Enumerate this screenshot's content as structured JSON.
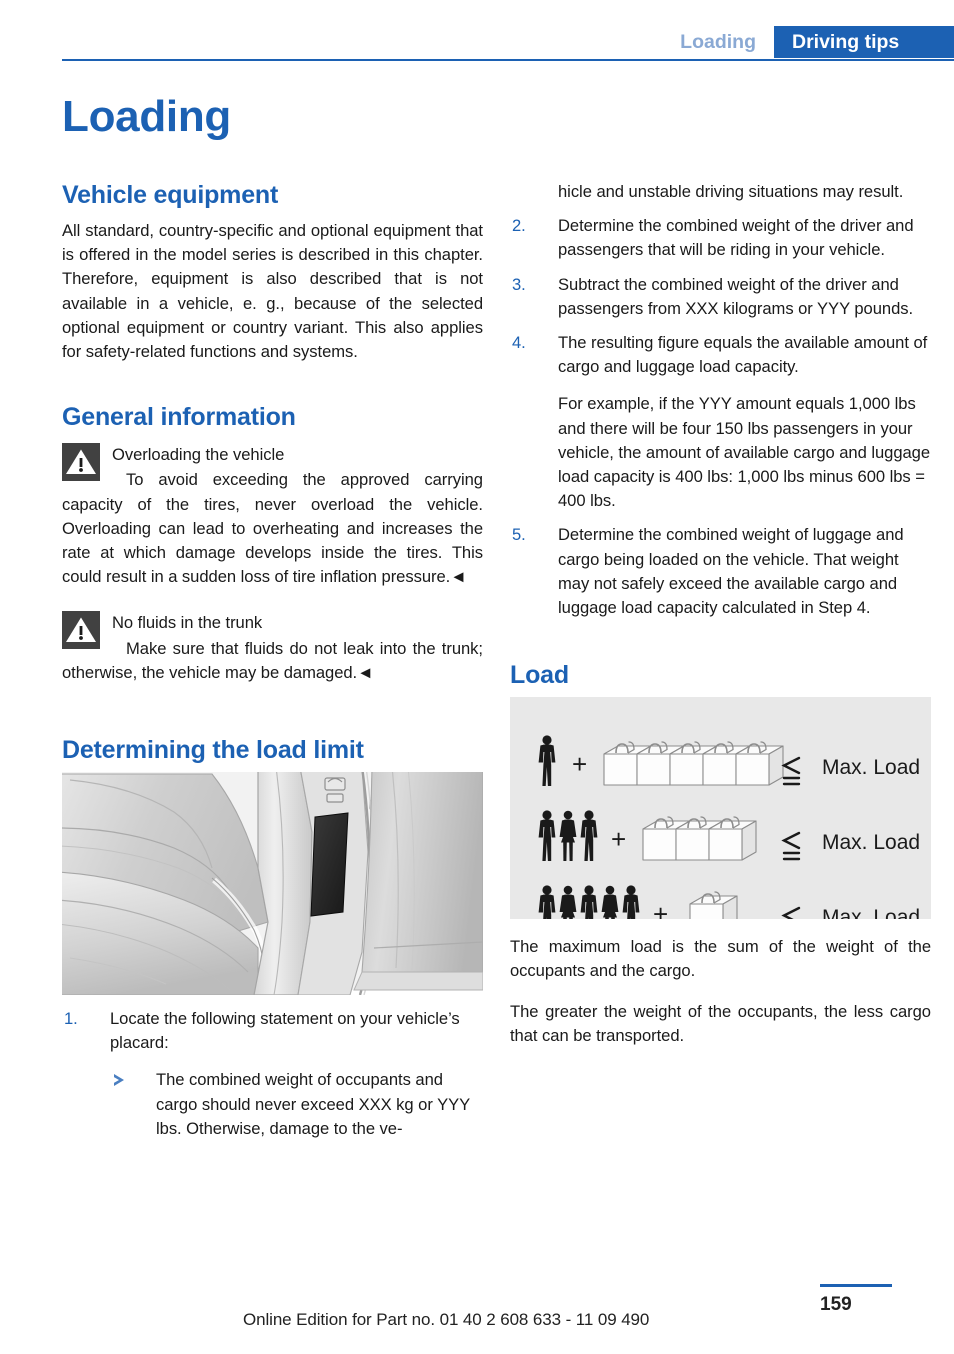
{
  "header": {
    "tab_inactive": "Loading",
    "tab_active": "Driving tips",
    "accent_color": "#1c61b3"
  },
  "page_title": "Loading",
  "left_column": {
    "vehicle_equipment": {
      "heading": "Vehicle equipment",
      "paragraph": "All standard, country-specific and optional equipment that is offered in the model series is described in this chapter. Therefore, equipment is also described that is not available in a vehicle, e. g., because of the selected optional equipment or country variant. This also applies for safety-related functions and systems."
    },
    "general_information": {
      "heading": "General information",
      "warnings": [
        {
          "icon": "warning-triangle-icon",
          "title": "Overloading the vehicle",
          "text": "To avoid exceeding the approved carrying capacity of the tires, never overload the vehicle. Overloading can lead to overheating and increases the rate at which damage develops inside the tires. This could result in a sudden loss of tire inflation pressure.◄"
        },
        {
          "icon": "warning-triangle-icon",
          "title": "No fluids in the trunk",
          "text": "Make sure that fluids do not leak into the trunk; otherwise, the vehicle may be damaged.◄"
        }
      ]
    },
    "load_limit": {
      "heading": "Determining the load limit",
      "figure_caption": "car-seat-and-door-pillar-placard-illustration",
      "step1": {
        "number": "1.",
        "text": "Locate the following statement on your vehicle’s placard:",
        "sub_bullets": [
          "The combined weight of occupants and cargo should never exceed XXX kg or YYY lbs. Otherwise, damage to the ve-"
        ]
      }
    }
  },
  "right_column": {
    "step1_continued": "hicle and unstable driving situations may result.",
    "steps": [
      {
        "number": "2.",
        "text": "Determine the combined weight of the driver and passengers that will be riding in your vehicle."
      },
      {
        "number": "3.",
        "text": "Subtract the combined weight of the driver and passengers from XXX kilograms or YYY pounds."
      },
      {
        "number": "4.",
        "text": "The resulting figure equals the available amount of cargo and luggage load capacity.",
        "continuation": "For example, if the YYY amount equals 1,000 lbs and there will be four 150 lbs passengers in your vehicle, the amount of available cargo and luggage load capacity is 400 lbs: 1,000 lbs minus 600 lbs = 400 lbs."
      },
      {
        "number": "5.",
        "text": "Determine the combined weight of luggage and cargo being loaded on the vehicle. That weight may not safely exceed the available cargo and luggage load capacity calculated in Step 4."
      }
    ],
    "load": {
      "heading": "Load",
      "diagram": {
        "rows": [
          {
            "people": 1,
            "suitcases": 5,
            "plus": "+",
            "operator": "≦",
            "label": "Max. Load"
          },
          {
            "people": 3,
            "suitcases": 3,
            "plus": "+",
            "operator": "≦",
            "label": "Max. Load"
          },
          {
            "people": 5,
            "suitcases": 1,
            "plus": "+",
            "operator": "≦",
            "label": "Max. Load"
          }
        ],
        "background_color": "#e8e8e8"
      },
      "paragraphs": [
        "The maximum load is the sum of the weight of the occupants and the cargo.",
        "The greater the weight of the occupants, the less cargo that can be transported."
      ]
    }
  },
  "footer": {
    "edition": "Online Edition for Part no. 01 40 2 608 633 - 11 09 490",
    "page_number": "159"
  }
}
